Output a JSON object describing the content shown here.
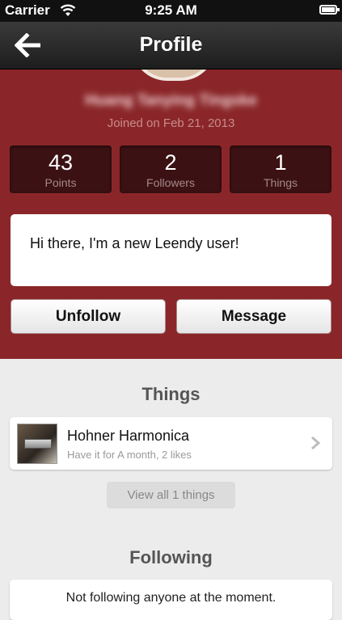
{
  "status_bar": {
    "carrier": "Carrier",
    "time": "9:25 AM",
    "wifi_icon": "wifi-icon",
    "battery_icon": "battery-icon"
  },
  "navbar": {
    "title": "Profile",
    "back_icon": "back-arrow-icon"
  },
  "profile": {
    "username": "Huang Tanying Tingske",
    "joined": "Joined on Feb 21, 2013",
    "accent_color": "#8a2629",
    "stats": [
      {
        "value": "43",
        "label": "Points"
      },
      {
        "value": "2",
        "label": "Followers"
      },
      {
        "value": "1",
        "label": "Things"
      }
    ],
    "bio": "Hi there, I'm a new Leendy user!",
    "buttons": {
      "unfollow": "Unfollow",
      "message": "Message"
    }
  },
  "things": {
    "title": "Things",
    "items": [
      {
        "name": "Hohner Harmonica",
        "meta": "Have it for A month, 2 likes",
        "thumb_icon": "harmonica-photo"
      }
    ],
    "view_all": "View all 1 things"
  },
  "following": {
    "title": "Following",
    "empty_text": "Not following anyone at the moment."
  }
}
